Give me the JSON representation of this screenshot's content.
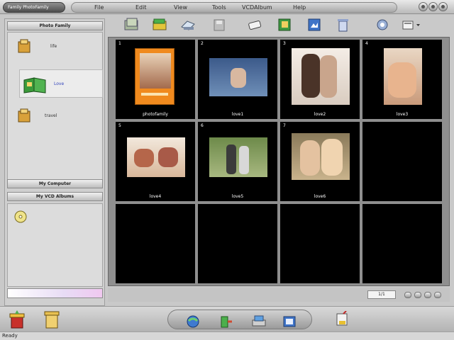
{
  "app": {
    "title": "Family PhotoFamily"
  },
  "menu": [
    "File",
    "Edit",
    "View",
    "Tools",
    "VCDAlbum",
    "Help"
  ],
  "left_panel": {
    "header": "Photo Family",
    "albums": [
      {
        "label": "life"
      },
      {
        "label": "Love"
      },
      {
        "label": "travel"
      }
    ],
    "my_computer": "My Computer",
    "my_vcd_albums": "My VCD Albums"
  },
  "photos": [
    {
      "num": "1",
      "label": "photofamily"
    },
    {
      "num": "2",
      "label": "love1"
    },
    {
      "num": "3",
      "label": "love2"
    },
    {
      "num": "4",
      "label": "love3"
    },
    {
      "num": "5",
      "label": "love4"
    },
    {
      "num": "6",
      "label": "love5"
    },
    {
      "num": "7",
      "label": "love6"
    }
  ],
  "pager": {
    "page": "1/1"
  },
  "status": {
    "text": "Ready"
  },
  "colors": {
    "cell_bg": "#000000",
    "frame": "#8f8f8f",
    "panel": "#cfcfcf"
  }
}
